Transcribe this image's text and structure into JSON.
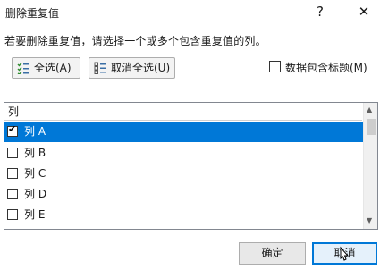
{
  "window": {
    "title": "删除重复值",
    "help_label": "?",
    "close_label": "✕"
  },
  "instruction": "若要删除重复值，请选择一个或多个包含重复值的列。",
  "toolbar": {
    "select_all_label": "全选(A)",
    "unselect_all_label": "取消全选(U)",
    "header_checkbox_label": "数据包含标题(M)",
    "header_checkbox_checked": false
  },
  "list": {
    "header": "列",
    "items": [
      {
        "label": "列 A",
        "checked": true,
        "selected": true
      },
      {
        "label": "列 B",
        "checked": false,
        "selected": false
      },
      {
        "label": "列 C",
        "checked": false,
        "selected": false
      },
      {
        "label": "列 D",
        "checked": false,
        "selected": false
      },
      {
        "label": "列 E",
        "checked": false,
        "selected": false
      }
    ]
  },
  "footer": {
    "ok_label": "确定",
    "cancel_label": "取消"
  },
  "colors": {
    "selection": "#0078d7",
    "focus_border": "#0078d7"
  },
  "icons": [
    "select-all-icon",
    "unselect-all-icon",
    "scroll-up-arrow-icon",
    "scroll-down-arrow-icon",
    "mouse-cursor-icon",
    "checkmark-icon"
  ]
}
